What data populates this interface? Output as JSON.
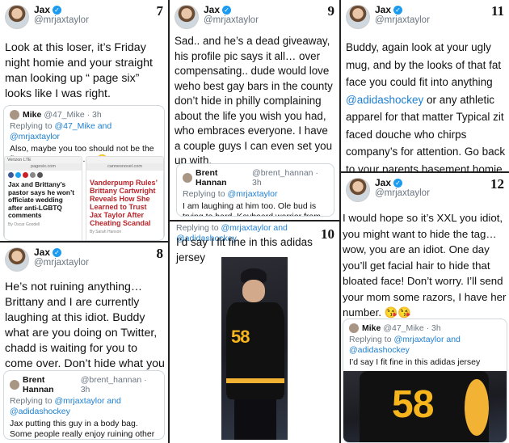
{
  "panels": {
    "p7": {
      "number": "7",
      "name": "Jax",
      "handle": "@mrjaxtaylor",
      "body": "Look at this loser, it’s Friday night homie and your  straight man looking up “ page six” looks like I was right.",
      "quote": {
        "name": "Mike",
        "meta": "@47_Mike · 3h",
        "reply_prefix": "Replying to ",
        "reply_mentions": "@47_Mike and @mrjaxtaylor",
        "text": "Also, maybe you too should not be the first to cast stones ......",
        "emoji": "😂",
        "media": {
          "left": {
            "status": "Verizon LTE",
            "url": "pagesix.com",
            "headline": "Jax and Brittany’s pastor says he won’t officiate wedding after anti-LGBTQ comments",
            "byline": "By Oscar Goodell"
          },
          "right": {
            "url": "cannesnovel.com",
            "headline": "Vanderpump Rules’ Brittany Cartwright Reveals How She Learned to Trust Jax Taylor After Cheating Scandal",
            "byline": "By Sarah Hanson"
          }
        }
      }
    },
    "p8": {
      "number": "8",
      "name": "Jax",
      "handle": "@mrjaxtaylor",
      "body": "He’s not ruining anything… Brittany and I are currently laughing at this idiot. Buddy what are you doing on Twitter, chadd is waiting for you to come over. Don’t hide what you are.",
      "quote": {
        "name": "Brent Hannan",
        "meta": "@brent_hannan · 3h",
        "reply_prefix": "Replying to ",
        "reply_mentions": "@mrjaxtaylor and @adidashockey",
        "text": "Jax putting this guy in a body bag. Some people really enjoy ruining other people relationship for no reason."
      }
    },
    "p9": {
      "number": "9",
      "name": "Jax",
      "handle": "@mrjaxtaylor",
      "body": "Sad.. and he’s a dead giveaway, his profile pic says it all… over compensating.. dude would love weho best gay bars in the county don’t hide in philly complaining about the life you wish you had, who embraces everyone. I have a couple guys I can even set you up with.",
      "quote": {
        "name": "Brent Hannan",
        "meta": "@brent_hannan · 3h",
        "reply_prefix": "Replying to ",
        "reply_mentions": "@mrjaxtaylor",
        "text": "I am laughing at him too. Ole bud is trying to hard. Keyboard warrior from moms basement."
      }
    },
    "p10": {
      "number": "10",
      "reply_prefix": "Replying to ",
      "reply_mentions": "@mrjaxtaylor and @adidashockey",
      "body": "I’d say I fit fine in this adidas jersey",
      "jersey_number": "58"
    },
    "p11": {
      "number": "11",
      "name": "Jax",
      "handle": "@mrjaxtaylor",
      "body_before": "Buddy, again look at your ugly mug, and by the looks of that fat face you could fit into anything ",
      "body_mention": "@adidashockey",
      "body_after": " or any athletic apparel for that matter Typical zit faced douche who chirps company’s for attention. Go back to your parents basement homie."
    },
    "p12": {
      "number": "12",
      "name": "Jax",
      "handle": "@mrjaxtaylor",
      "body": "I would hope so it’s XXL you idiot, you might want to hide the tag… wow, you are an idiot. One day you’ll get facial hair to hide that bloated face! Don’t worry. I’ll send your mom some razors, I have her number. 😘😘",
      "quote": {
        "name": "Mike",
        "meta": "@47_Mike · 3h",
        "reply_prefix": "Replying to ",
        "reply_mentions": "@mrjaxtaylor and @adidashockey",
        "text": "I’d say I fit fine in this adidas jersey",
        "jersey_number": "58"
      }
    }
  },
  "colors": {
    "link": "#1d7fd0",
    "verified": "#1d9bf0",
    "muted": "#6b7680",
    "jersey_gold": "#f6b51c"
  },
  "icons": {
    "verified": "verified-badge-icon",
    "avatar": "profile-avatar"
  }
}
